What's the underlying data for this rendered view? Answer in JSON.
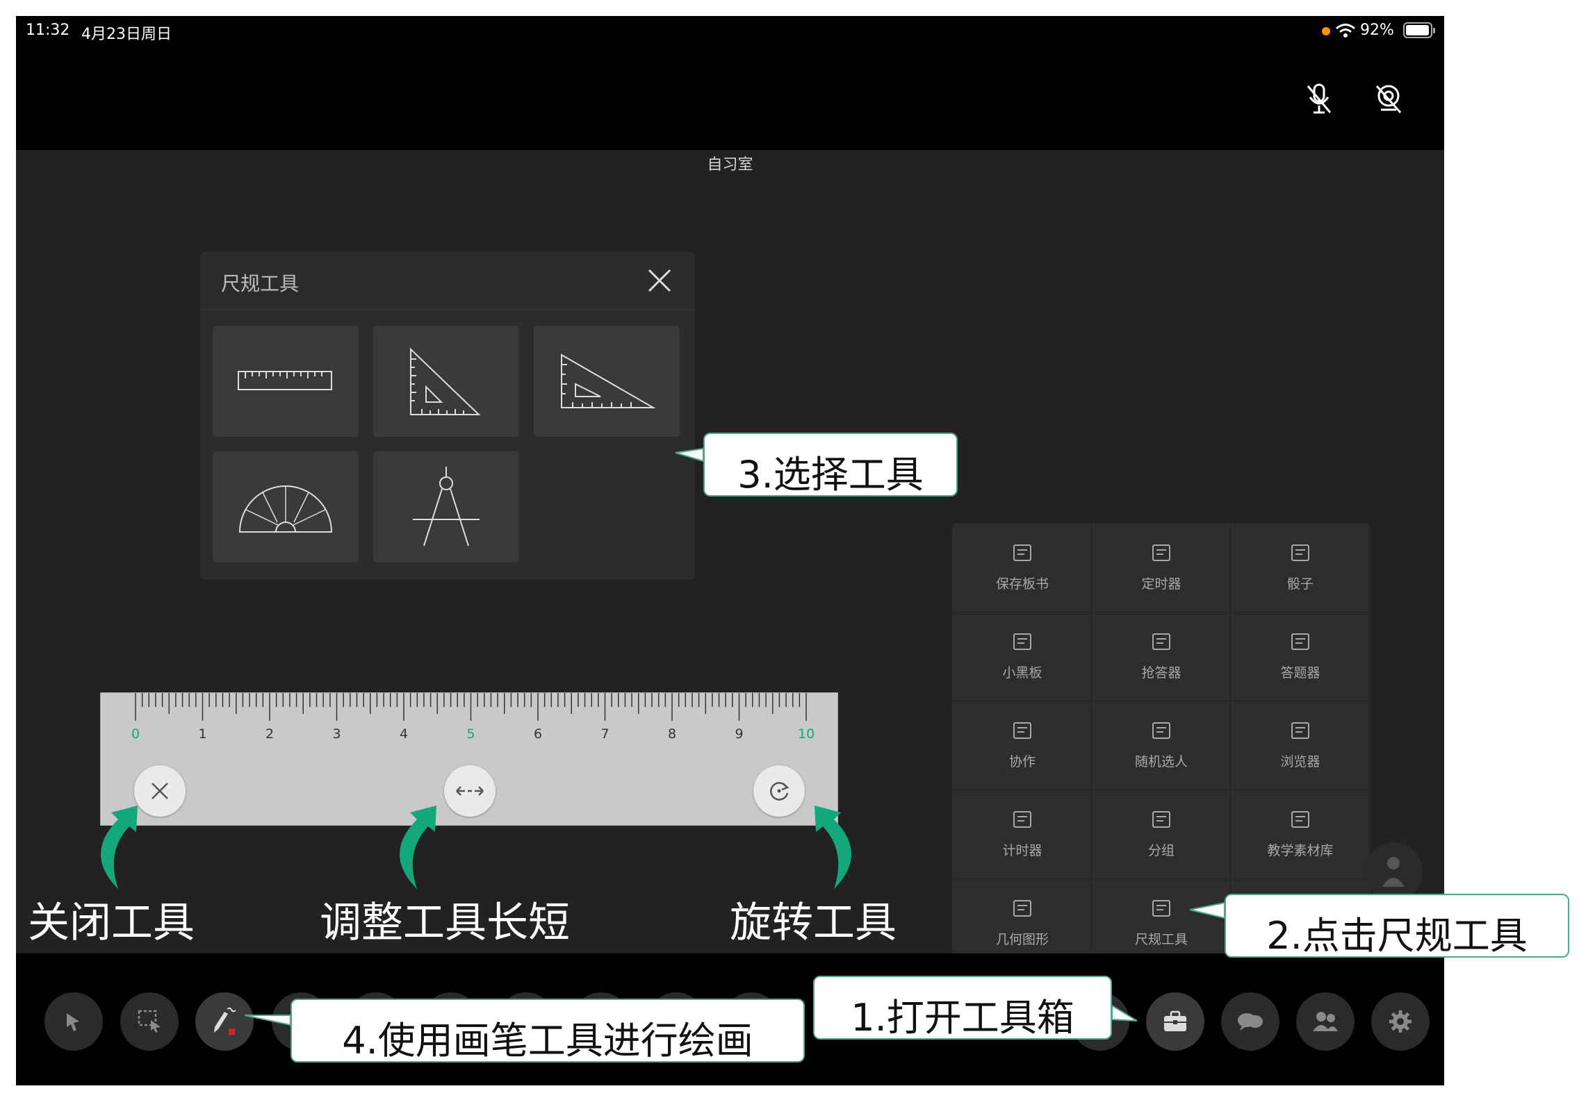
{
  "status": {
    "time": "11:32",
    "date": "4月23日周日",
    "battery": "92%"
  },
  "room": {
    "title": "自习室"
  },
  "ruler_panel": {
    "title": "尺规工具"
  },
  "toolbox": {
    "items": [
      {
        "label": "保存板书",
        "icon": "save-board-icon"
      },
      {
        "label": "定时器",
        "icon": "countdown-timer-icon"
      },
      {
        "label": "骰子",
        "icon": "dice-icon"
      },
      {
        "label": "小黑板",
        "icon": "blackboard-icon"
      },
      {
        "label": "抢答器",
        "icon": "buzzer-icon"
      },
      {
        "label": "答题器",
        "icon": "answer-card-icon"
      },
      {
        "label": "协作",
        "icon": "collaboration-icon"
      },
      {
        "label": "随机选人",
        "icon": "random-pick-icon"
      },
      {
        "label": "浏览器",
        "icon": "browser-icon"
      },
      {
        "label": "计时器",
        "icon": "stopwatch-icon"
      },
      {
        "label": "分组",
        "icon": "group-icon"
      },
      {
        "label": "教学素材库",
        "icon": "material-library-icon"
      },
      {
        "label": "几何图形",
        "icon": "geometry-shapes-icon"
      },
      {
        "label": "尺规工具",
        "icon": "ruler-tool-icon"
      }
    ]
  },
  "ruler": {
    "ticks": [
      "0",
      "1",
      "2",
      "3",
      "4",
      "5",
      "6",
      "7",
      "8",
      "9",
      "10"
    ]
  },
  "callouts": {
    "step1": "1.打开工具箱",
    "step2": "2.点击尺规工具",
    "step3": "3.选择工具",
    "step4": "4.使用画笔工具进行绘画"
  },
  "labels": {
    "close_tool": "关闭工具",
    "adjust_length": "调整工具长短",
    "rotate_tool": "旋转工具"
  },
  "colors": {
    "accent_green": "#14a77c",
    "callout_border": "#4fa88a",
    "battery_dot": "#ff9500",
    "pen_red": "#e02020"
  }
}
